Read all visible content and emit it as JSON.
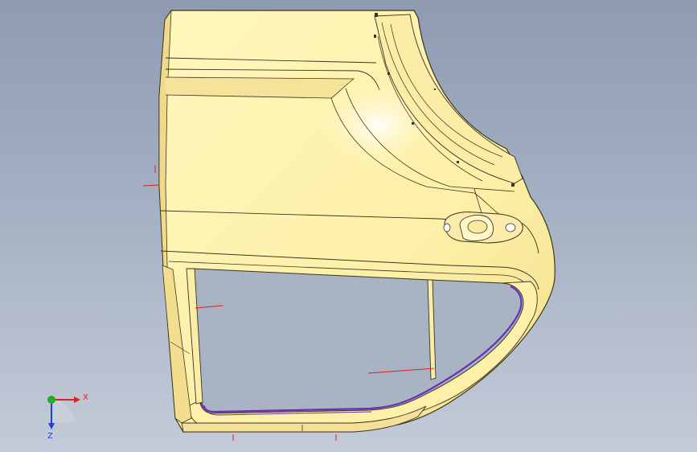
{
  "viewport": {
    "background_top": "#8e9bb1",
    "background_bottom": "#c3cbd8"
  },
  "part": {
    "name_icon": "door-panel-model",
    "face_color": "#fdf0a8",
    "edge_color": "#3a3520",
    "shadow_color": "#e9d27c",
    "window_seal_color": "#6b2fb0",
    "datum_color": "#e02020"
  },
  "triad": {
    "x_label": "X",
    "z_label": "Z",
    "x_color": "#e02020",
    "y_color": "#20b020",
    "z_color": "#2040d0"
  }
}
